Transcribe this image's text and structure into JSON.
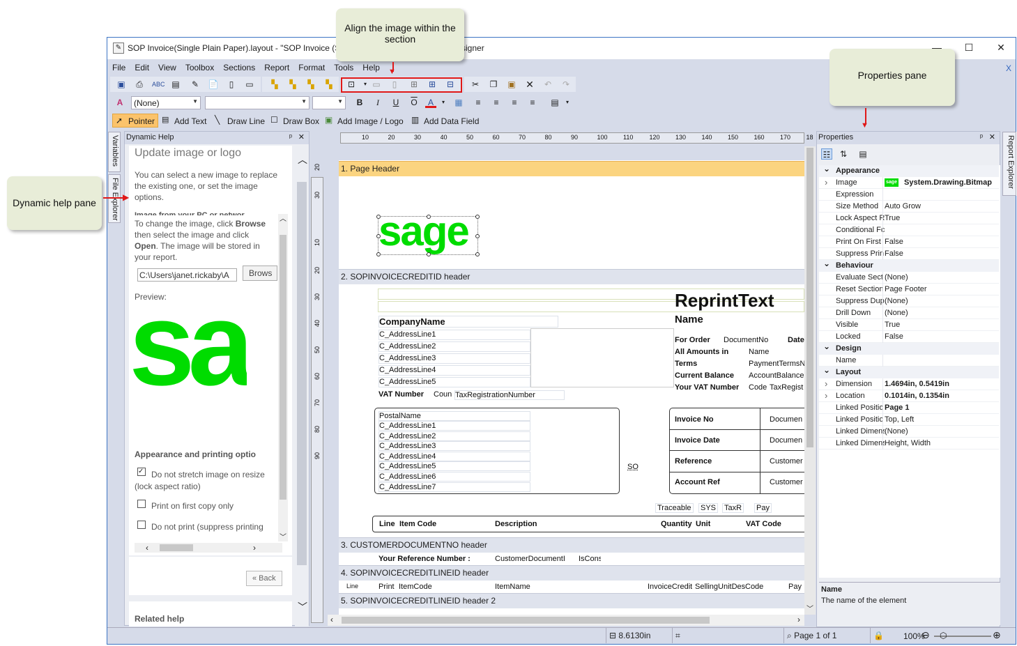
{
  "window": {
    "title": "SOP Invoice(Single Plain Paper).layout - \"SOP Invoice (Si",
    "title_end": "signer",
    "close_x": "X"
  },
  "menu": [
    "File",
    "Edit",
    "View",
    "Toolbox",
    "Sections",
    "Report",
    "Format",
    "Tools",
    "Help"
  ],
  "format_bar": {
    "style_value": "(None)",
    "bold": "B",
    "italic": "I",
    "underline": "U",
    "overline": "O",
    "color": "A"
  },
  "toolbox": {
    "pointer": "Pointer",
    "add_text": "Add Text",
    "draw_line": "Draw Line",
    "draw_box": "Draw Box",
    "add_image": "Add Image / Logo",
    "add_data": "Add Data Field"
  },
  "side_tabs": {
    "variables": "Variables",
    "file_explorer": "File Explorer",
    "report_explorer": "Report Explorer"
  },
  "help": {
    "pane_title": "Dynamic Help",
    "heading": "Update image or logo",
    "intro": "You can select a new image to replace the existing one, or set the image options.",
    "sub_heading": "Image from your PC or networ",
    "instructions_a": "To change the image, click ",
    "browse_word": "Browse",
    "instructions_b": " then select the image and click ",
    "open_word": "Open",
    "instructions_c": ". The image will be stored in your report.",
    "path_value": "C:\\Users\\janet.rickaby\\A",
    "browse_btn": "Brows",
    "preview_label": "Preview:",
    "preview_text": "sa",
    "appearance_heading": "Appearance and printing optio",
    "opt1": "Do not stretch image on resize (lock aspect ratio)",
    "opt2": "Print on first copy only",
    "opt3": "Do not print (suppress printing",
    "back": "« Back",
    "related": "Related help"
  },
  "ruler_h": [
    "10",
    "20",
    "30",
    "40",
    "50",
    "60",
    "70",
    "80",
    "90",
    "100",
    "110",
    "120",
    "130",
    "140",
    "150",
    "160",
    "170",
    "18"
  ],
  "ruler_v": [
    "10",
    "20",
    "30",
    "10",
    "20",
    "30",
    "40",
    "50",
    "60",
    "70",
    "80",
    "90"
  ],
  "sections": [
    "1. Page Header",
    "2. SOPINVOICECREDITID header",
    "3. CUSTOMERDOCUMENTNO header",
    "4. SOPINVOICECREDITLINEID header",
    "5. SOPINVOICECREDITLINEID header 2"
  ],
  "logo": "sage",
  "canvas": {
    "reprint": "ReprintText",
    "name": "Name",
    "company": "CompanyName",
    "addr": [
      "C_AddressLine1",
      "C_AddressLine2",
      "C_AddressLine3",
      "C_AddressLine4",
      "C_AddressLine5"
    ],
    "vat_label": "VAT Number",
    "vat_c": "Coun",
    "vat_val": "TaxRegistrationNumber",
    "order_labels": [
      "For Order",
      "All Amounts in",
      "Terms",
      "Current Balance",
      "Your VAT Number"
    ],
    "order_vals": [
      "DocumentNo",
      "Name",
      "PaymentTermsN",
      "AccountBalance",
      "Code"
    ],
    "date": "Date",
    "vat_code2": "TaxRegist",
    "postal": "PostalName",
    "deliv": [
      "C_AddressLine1",
      "C_AddressLine2",
      "C_AddressLine3",
      "C_AddressLine4",
      "C_AddressLine5",
      "C_AddressLine6",
      "C_AddressLine7"
    ],
    "so": "SO",
    "inv_labels": [
      "Invoice No",
      "Invoice Date",
      "Reference",
      "Account Ref"
    ],
    "inv_vals": [
      "Documen",
      "Documen",
      "Customer",
      "Customer"
    ],
    "mini": [
      "Traceable",
      "SYS",
      "TaxR",
      "Pay"
    ],
    "cols": [
      "Line",
      "Item Code",
      "Description",
      "Quantity",
      "Unit",
      "VAT Code"
    ],
    "your_ref": "Your Reference Number :",
    "cust_doc": "CustomerDocumentI",
    "iscons": "IsCons",
    "line_row": [
      "Line",
      "Print",
      "ItemCode",
      "ItemName",
      "InvoiceCredit",
      "SellingUnitDes",
      "Code",
      "Pay"
    ]
  },
  "props": {
    "title": "Properties",
    "rows": [
      {
        "cat": "Appearance"
      },
      {
        "n": "Image",
        "v": "System.Drawing.Bitmap",
        "b": true,
        "exp": true,
        "thumb": "sage"
      },
      {
        "n": "Expression",
        "v": ""
      },
      {
        "n": "Size Method",
        "v": "Auto Grow"
      },
      {
        "n": "Lock Aspect R",
        "v": "True"
      },
      {
        "n": "Conditional Fc",
        "v": ""
      },
      {
        "n": "Print On First",
        "v": "False"
      },
      {
        "n": "Suppress Prin",
        "v": "False"
      },
      {
        "cat": "Behaviour"
      },
      {
        "n": "Evaluate Sect",
        "v": "(None)"
      },
      {
        "n": "Reset Section",
        "v": "Page Footer"
      },
      {
        "n": "Suppress Dup",
        "v": "(None)"
      },
      {
        "n": "Drill Down",
        "v": "(None)"
      },
      {
        "n": "Visible",
        "v": "True"
      },
      {
        "n": "Locked",
        "v": "False"
      },
      {
        "cat": "Design"
      },
      {
        "n": "Name",
        "v": ""
      },
      {
        "cat": "Layout"
      },
      {
        "n": "Dimension",
        "v": "1.4694in, 0.5419in",
        "b": true,
        "exp": true
      },
      {
        "n": "Location",
        "v": "0.1014in, 0.1354in",
        "b": true,
        "exp": true
      },
      {
        "n": "Linked Positio",
        "v": "Page 1",
        "b": true
      },
      {
        "n": "Linked Positio",
        "v": "Top, Left"
      },
      {
        "n": "Linked Dimens",
        "v": "(None)"
      },
      {
        "n": "Linked Dimens",
        "v": "Height, Width"
      }
    ],
    "desc_title": "Name",
    "desc_text": "The name of the element"
  },
  "status": {
    "dim": "8.6130in",
    "page": "Page 1 of 1",
    "zoom": "100%"
  },
  "callouts": {
    "align": "Align the image within the section",
    "props": "Properties pane",
    "help": "Dynamic help pane"
  },
  "colors": {
    "accent": "#e01818",
    "sage": "#00dc00",
    "header_band": "#fbd480"
  }
}
